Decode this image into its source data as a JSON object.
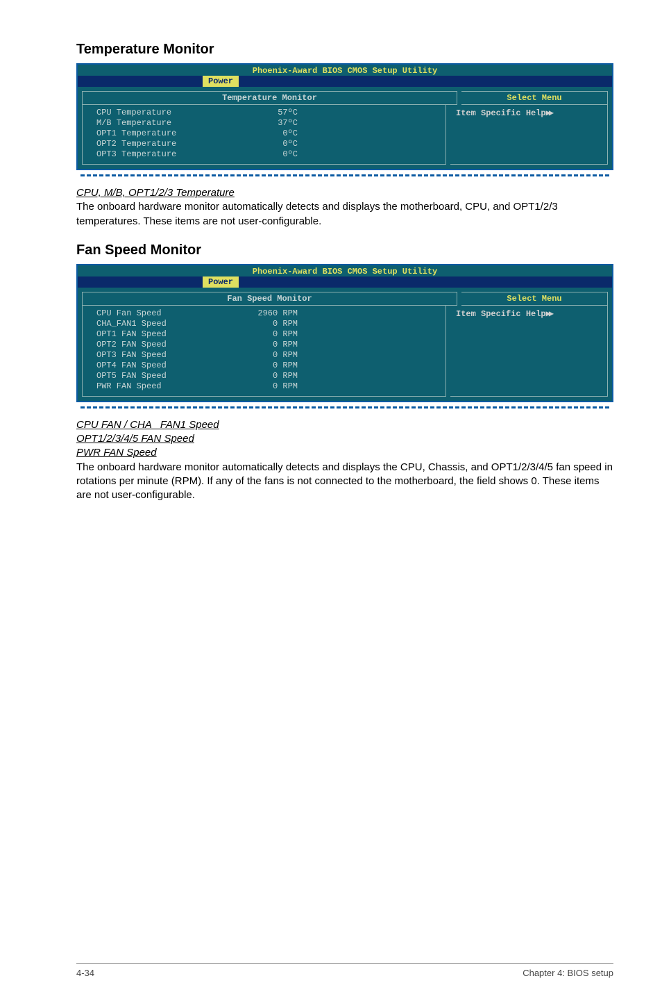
{
  "section1": {
    "heading": "Temperature Monitor",
    "bios_title": "Phoenix-Award BIOS CMOS Setup Utility",
    "menu_tab": "Power",
    "sub_left": "Temperature Monitor",
    "sub_right": "Select Menu",
    "help_text": "Item Specific Help",
    "rows": [
      {
        "key": "CPU Temperature",
        "val": "57ºC"
      },
      {
        "key": "M/B Temperature",
        "val": "37ºC"
      },
      {
        "key": "OPT1 Temperature",
        "val": "0ºC"
      },
      {
        "key": "OPT2 Temperature",
        "val": "0ºC"
      },
      {
        "key": "OPT3 Temperature",
        "val": "0ºC"
      }
    ],
    "subhead": "CPU, M/B, OPT1/2/3 Temperature",
    "para": "The onboard hardware monitor automatically detects and displays the motherboard, CPU, and OPT1/2/3 temperatures. These items are not user-configurable."
  },
  "section2": {
    "heading": "Fan Speed Monitor",
    "bios_title": "Phoenix-Award BIOS CMOS Setup Utility",
    "menu_tab": "Power",
    "sub_left": "Fan Speed Monitor",
    "sub_right": "Select Menu",
    "help_text": "Item Specific Help",
    "rows": [
      {
        "key": "CPU Fan Speed",
        "val": "2960 RPM"
      },
      {
        "key": "CHA_FAN1 Speed",
        "val": "0 RPM"
      },
      {
        "key": "OPT1 FAN Speed",
        "val": "0 RPM"
      },
      {
        "key": "OPT2 FAN Speed",
        "val": "0 RPM"
      },
      {
        "key": "OPT3 FAN Speed",
        "val": "0 RPM"
      },
      {
        "key": "OPT4 FAN Speed",
        "val": "0 RPM"
      },
      {
        "key": "OPT5 FAN Speed",
        "val": "0 RPM"
      },
      {
        "key": "PWR FAN Speed",
        "val": "0 RPM"
      }
    ],
    "subhead1": "CPU FAN / CHA _FAN1 Speed",
    "subhead2": "OPT1/2/3/4/5 FAN Speed",
    "subhead3": "PWR FAN Speed",
    "para": "The onboard hardware monitor automatically detects and displays the CPU, Chassis, and OPT1/2/3/4/5 fan speed in rotations per minute (RPM). If any of the fans is not connected to the motherboard, the field shows 0. These items are not user-configurable."
  },
  "footer": {
    "left": "4-34",
    "right": "Chapter 4: BIOS setup"
  }
}
